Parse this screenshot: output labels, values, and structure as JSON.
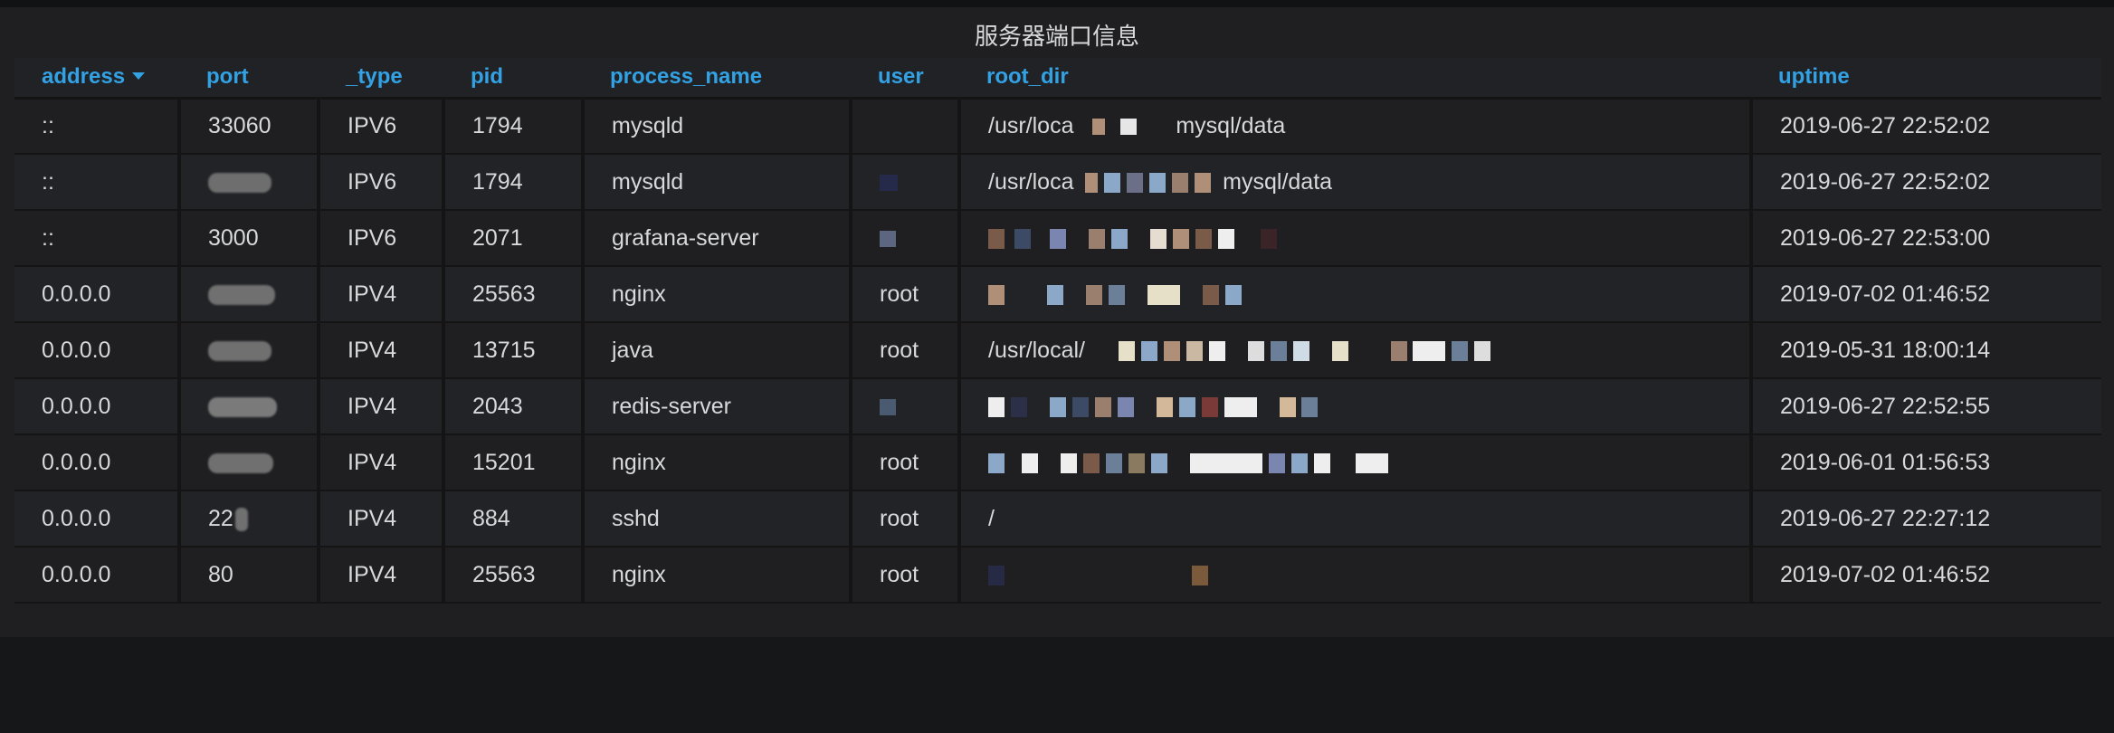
{
  "panel": {
    "title": "服务器端口信息"
  },
  "table": {
    "columns": [
      {
        "key": "address",
        "label": "address",
        "sorted": "desc"
      },
      {
        "key": "port",
        "label": "port"
      },
      {
        "key": "_type",
        "label": "_type"
      },
      {
        "key": "pid",
        "label": "pid"
      },
      {
        "key": "process_name",
        "label": "process_name"
      },
      {
        "key": "user",
        "label": "user"
      },
      {
        "key": "root_dir",
        "label": "root_dir"
      },
      {
        "key": "uptime",
        "label": "uptime"
      }
    ],
    "rows": [
      {
        "address": "::",
        "port": "33060",
        "type": "IPV6",
        "pid": "1794",
        "process_name": "mysqld",
        "user": "",
        "root_dir": "/usr/loca",
        "root_dir_tail": "mysql/data",
        "uptime": "2019-06-27 22:52:02"
      },
      {
        "address": "::",
        "port": "",
        "type": "IPV6",
        "pid": "1794",
        "process_name": "mysqld",
        "user": "",
        "root_dir": "/usr/loca",
        "root_dir_tail": "mysql/data",
        "uptime": "2019-06-27 22:52:02"
      },
      {
        "address": "::",
        "port": "3000",
        "type": "IPV6",
        "pid": "2071",
        "process_name": "grafana-server",
        "user": "",
        "root_dir": "",
        "root_dir_tail": "",
        "uptime": "2019-06-27 22:53:00"
      },
      {
        "address": "0.0.0.0",
        "port": "",
        "type": "IPV4",
        "pid": "25563",
        "process_name": "nginx",
        "user": "root",
        "root_dir": "",
        "root_dir_tail": "",
        "uptime": "2019-07-02 01:46:52"
      },
      {
        "address": "0.0.0.0",
        "port": "",
        "type": "IPV4",
        "pid": "13715",
        "process_name": "java",
        "user": "root",
        "root_dir": "/usr/local/",
        "root_dir_tail": "",
        "uptime": "2019-05-31 18:00:14"
      },
      {
        "address": "0.0.0.0",
        "port": "",
        "type": "IPV4",
        "pid": "2043",
        "process_name": "redis-server",
        "user": "",
        "root_dir": "",
        "root_dir_tail": "",
        "uptime": "2019-06-27 22:52:55"
      },
      {
        "address": "0.0.0.0",
        "port": "",
        "type": "IPV4",
        "pid": "15201",
        "process_name": "nginx",
        "user": "root",
        "root_dir": "",
        "root_dir_tail": "",
        "uptime": "2019-06-01 01:56:53"
      },
      {
        "address": "0.0.0.0",
        "port": "22",
        "type": "IPV4",
        "pid": "884",
        "process_name": "sshd",
        "user": "root",
        "root_dir": "/",
        "root_dir_tail": "",
        "uptime": "2019-06-27 22:27:12"
      },
      {
        "address": "0.0.0.0",
        "port": "80",
        "type": "IPV4",
        "pid": "25563",
        "process_name": "nginx",
        "user": "root",
        "root_dir": "",
        "root_dir_tail": "",
        "uptime": "2019-07-02 01:46:52"
      }
    ]
  },
  "colors": {
    "header_text": "#33a2e5",
    "cell_text": "#d8d9da",
    "panel_bg": "#1f1f22",
    "page_bg": "#161719"
  }
}
